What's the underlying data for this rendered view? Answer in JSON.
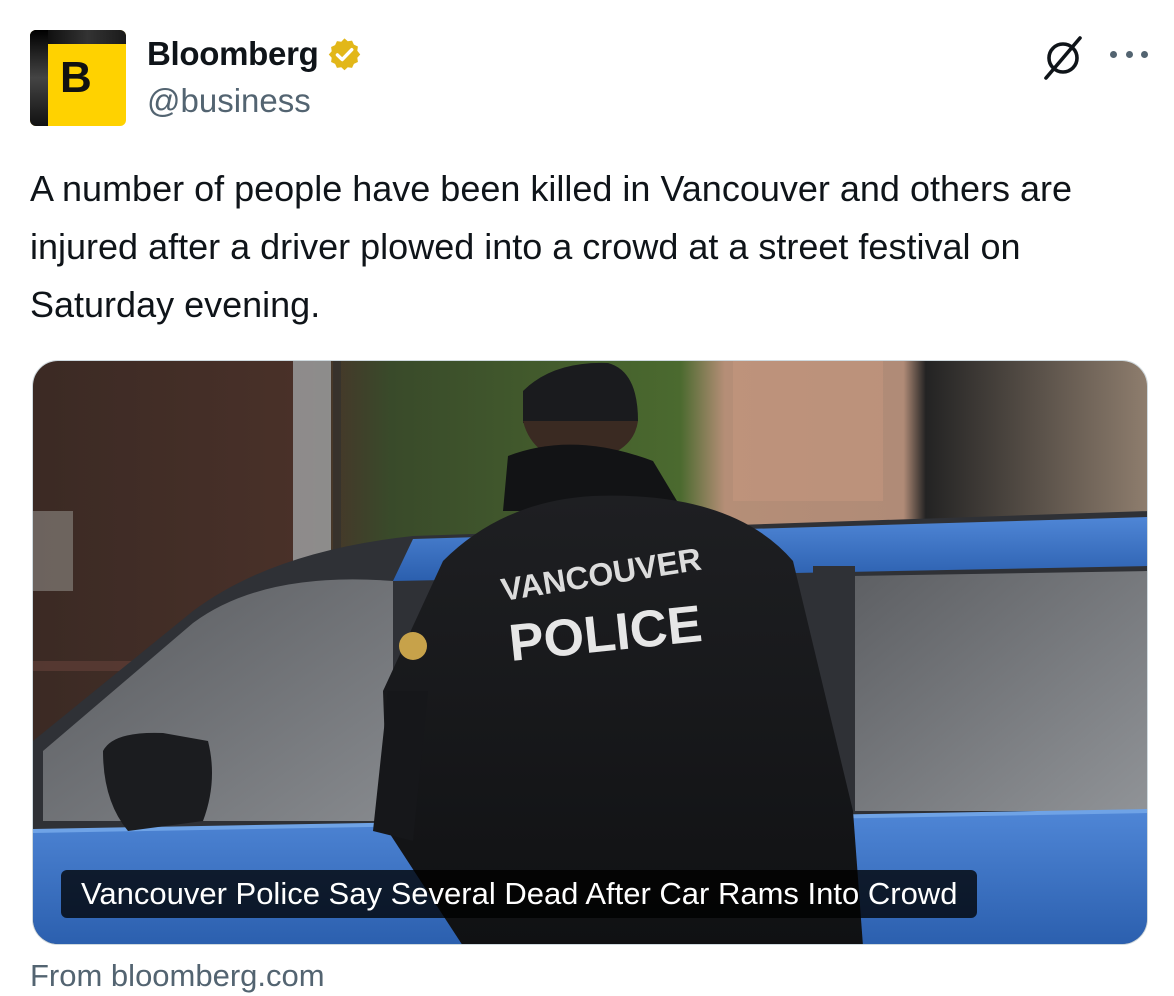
{
  "account": {
    "avatar_letter": "B",
    "display_name": "Bloomberg",
    "handle": "@business",
    "verified_badge_color": "#e2b719"
  },
  "icons": {
    "grok": "grok-icon",
    "more": "more-options-icon",
    "verified": "verified-badge-icon"
  },
  "tweet": {
    "text": "A number of people have been killed in Vancouver and others are injured after a driver plowed into a crowd at a street festival on Saturday evening."
  },
  "card": {
    "image_jacket_text_line1": "VANCOUVER",
    "image_jacket_text_line2": "POLICE",
    "headline": "Vancouver Police Say Several Dead After Car Rams Into Crowd",
    "source": "From bloomberg.com"
  },
  "colors": {
    "text_primary": "#0f1419",
    "text_secondary": "#536471",
    "avatar_yellow": "#ffd200",
    "card_border": "#cfd9de"
  }
}
